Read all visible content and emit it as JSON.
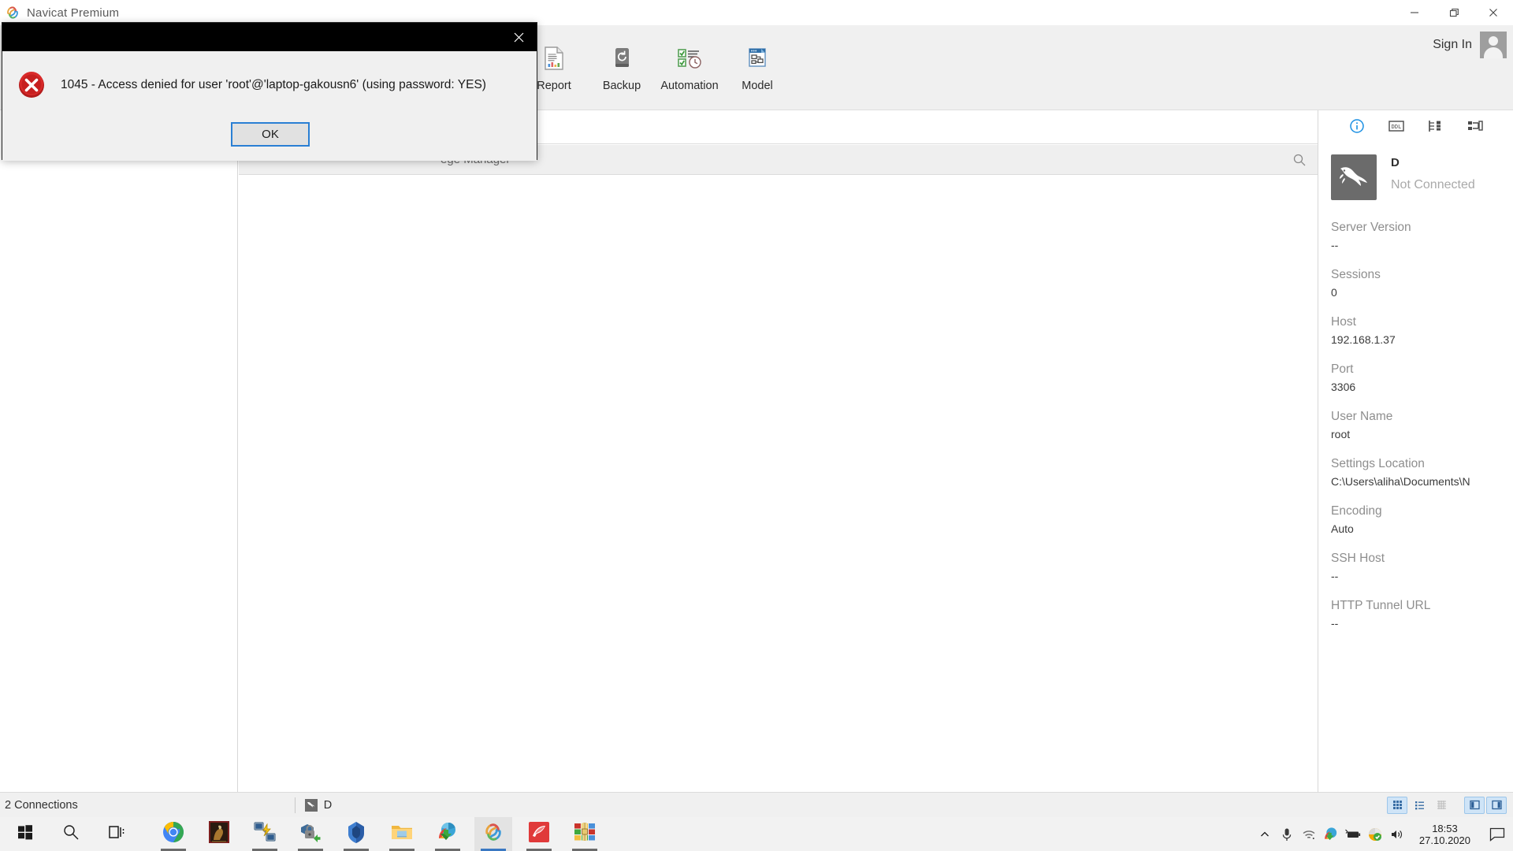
{
  "window": {
    "title": "Navicat Premium",
    "app_icon": "navicat-logo-icon",
    "minimize_label": "Minimize",
    "restore_label": "Restore",
    "close_label": "Close"
  },
  "ribbon": {
    "signin_label": "Sign In",
    "avatar_name": "user-avatar",
    "items": [
      {
        "label": "Report",
        "icon": "report-icon"
      },
      {
        "label": "Backup",
        "icon": "backup-icon"
      },
      {
        "label": "Automation",
        "icon": "automation-icon"
      },
      {
        "label": "Model",
        "icon": "model-icon"
      }
    ]
  },
  "breadcrumb": {
    "text": "ege Manager",
    "search_icon": "search-icon"
  },
  "info_panel": {
    "tabs": [
      {
        "name": "info-tab",
        "icon": "info-circle-icon",
        "active": true
      },
      {
        "name": "ddl-tab",
        "icon": "ddl-icon",
        "active": false
      },
      {
        "name": "objects-tab",
        "icon": "objects-tree-icon",
        "active": false
      },
      {
        "name": "relations-tab",
        "icon": "relations-icon",
        "active": false
      }
    ],
    "connection_name": "D",
    "connection_status": "Not Connected",
    "connection_icon": "mysql-dolphin-icon",
    "rows": [
      {
        "key": "Server Version",
        "value": "--"
      },
      {
        "key": "Sessions",
        "value": "0"
      },
      {
        "key": "Host",
        "value": "192.168.1.37"
      },
      {
        "key": "Port",
        "value": "3306"
      },
      {
        "key": "User Name",
        "value": "root"
      },
      {
        "key": "Settings Location",
        "value": "C:\\Users\\aliha\\Documents\\N"
      },
      {
        "key": "Encoding",
        "value": "Auto"
      },
      {
        "key": "SSH Host",
        "value": "--"
      },
      {
        "key": "HTTP Tunnel URL",
        "value": "--"
      }
    ]
  },
  "statusbar": {
    "connections_label": "2 Connections",
    "active_connection": "D",
    "active_connection_icon": "mysql-dolphin-icon",
    "view_toggles": [
      {
        "name": "grid-view-toggle",
        "icon": "grid-icon",
        "active": true
      },
      {
        "name": "list-view-toggle",
        "icon": "list-icon",
        "active": false
      },
      {
        "name": "detail-view-toggle",
        "icon": "detail-grid-icon",
        "active": false
      },
      {
        "name": "left-pane-toggle",
        "icon": "left-panel-icon",
        "active": true
      },
      {
        "name": "right-pane-toggle",
        "icon": "right-panel-icon",
        "active": true
      }
    ]
  },
  "dialog": {
    "title": "",
    "close_label": "Close",
    "error_icon": "error-cross-icon",
    "message": "1045 - Access denied for user 'root'@'laptop-gakousn6' (using password: YES)",
    "ok_label": "OK"
  },
  "taskbar": {
    "items": [
      {
        "name": "start-button",
        "icon": "windows-start-icon",
        "running": false
      },
      {
        "name": "search-button",
        "icon": "search-icon",
        "running": false
      },
      {
        "name": "task-view-button",
        "icon": "task-view-icon",
        "running": false
      },
      {
        "name": "chrome-taskbar-item",
        "icon": "chrome-icon",
        "running": true
      },
      {
        "name": "game-taskbar-item",
        "icon": "game-artwork-icon",
        "running": false
      },
      {
        "name": "network-tool-taskbar-item",
        "icon": "network-tool-icon",
        "running": true
      },
      {
        "name": "secure-transfer-taskbar-item",
        "icon": "lock-arrow-icon",
        "running": true
      },
      {
        "name": "blue-diamond-taskbar-item",
        "icon": "blue-diamond-icon",
        "running": true
      },
      {
        "name": "file-explorer-taskbar-item",
        "icon": "folder-icon",
        "running": true
      },
      {
        "name": "idm-taskbar-item",
        "icon": "idm-globe-icon",
        "running": true
      },
      {
        "name": "navicat-taskbar-item",
        "icon": "navicat-logo-icon",
        "running": true,
        "active": true
      },
      {
        "name": "xmind-taskbar-item",
        "icon": "red-arrow-icon",
        "running": true
      },
      {
        "name": "winrar-taskbar-item",
        "icon": "winrar-books-icon",
        "running": true
      }
    ],
    "tray": [
      {
        "name": "show-hidden-icons",
        "icon": "chevron-up-icon"
      },
      {
        "name": "microphone-tray-icon",
        "icon": "microphone-icon"
      },
      {
        "name": "network-tray-icon",
        "icon": "wifi-icon"
      },
      {
        "name": "idm-tray-icon",
        "icon": "idm-globe-icon"
      },
      {
        "name": "battery-tray-icon",
        "icon": "battery-icon"
      },
      {
        "name": "security-tray-icon",
        "icon": "security-check-icon"
      },
      {
        "name": "volume-tray-icon",
        "icon": "speaker-icon"
      }
    ],
    "clock_time": "18:53",
    "clock_date": "27.10.2020",
    "action_center_icon": "action-center-icon"
  }
}
